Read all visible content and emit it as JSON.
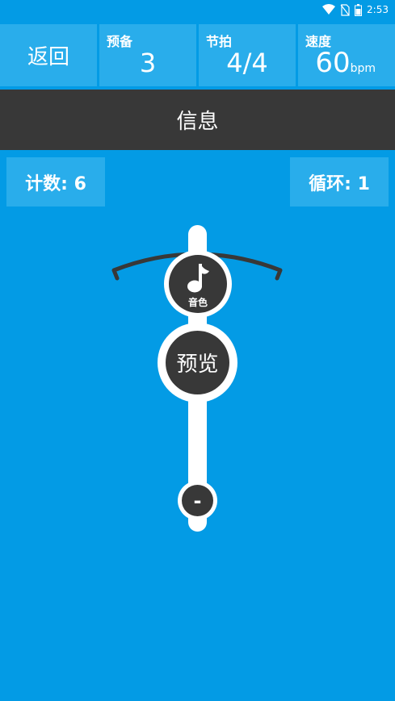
{
  "status_bar": {
    "time": "2:53",
    "icons": [
      "wifi-icon",
      "no-sim-icon",
      "battery-icon"
    ]
  },
  "header": {
    "back_label": "返回",
    "prep": {
      "title": "预备",
      "value": "3"
    },
    "beat": {
      "title": "节拍",
      "value": "4/4"
    },
    "speed": {
      "title": "速度",
      "value": "60",
      "unit": "bpm"
    }
  },
  "info_bar": {
    "label": "信息"
  },
  "counters": {
    "count_label": "计数: 6",
    "loop_label": "循环: 1"
  },
  "metronome": {
    "timbre_label": "音色",
    "timbre_icon": "music-note-icon",
    "preview_label": "预览",
    "minus_label": "-"
  },
  "colors": {
    "background": "#039BE5",
    "cell": "#29ADEB",
    "dark": "#383838",
    "white": "#FFFFFF"
  }
}
